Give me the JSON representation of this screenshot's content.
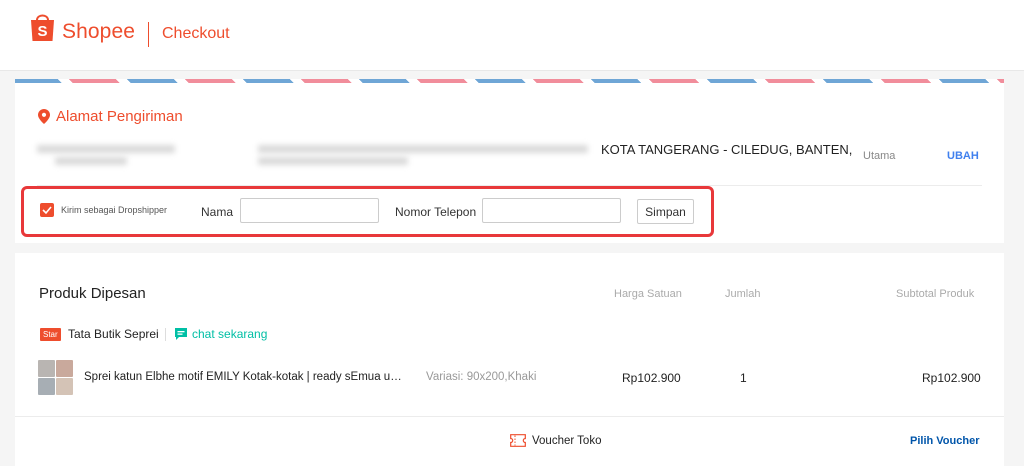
{
  "header": {
    "brand": "Shopee",
    "title": "Checkout",
    "brand_color": "#ee4d2d"
  },
  "address": {
    "heading": "Alamat Pengiriman",
    "city_line": "KOTA TANGERANG - CILEDUG, BANTEN,",
    "tag": "Utama",
    "change_label": "UBAH",
    "icon": "location-pin-icon"
  },
  "dropshipper": {
    "checkbox_label": "Kirim sebagai Dropshipper",
    "checked": true,
    "name_label": "Nama",
    "name_value": "",
    "phone_label": "Nomor Telepon",
    "phone_value": "",
    "save_label": "Simpan",
    "highlight_color": "#e8383a"
  },
  "products": {
    "title": "Produk Dipesan",
    "columns": {
      "unit_price": "Harga Satuan",
      "quantity": "Jumlah",
      "subtotal": "Subtotal Produk"
    },
    "shop": {
      "badge": "Star",
      "name": "Tata Butik Seprei",
      "chat_label": "chat sekarang",
      "chat_icon": "chat-icon"
    },
    "items": [
      {
        "name": "Sprei katun Elbhe motif EMILY Kotak-kotak | ready sEmua uk...",
        "variation": "Variasi: 90x200,Khaki",
        "unit_price": "Rp102.900",
        "quantity": "1",
        "subtotal": "Rp102.900"
      }
    ],
    "voucher": {
      "label": "Voucher Toko",
      "action": "Pilih Voucher",
      "icon": "voucher-ticket-icon"
    }
  }
}
